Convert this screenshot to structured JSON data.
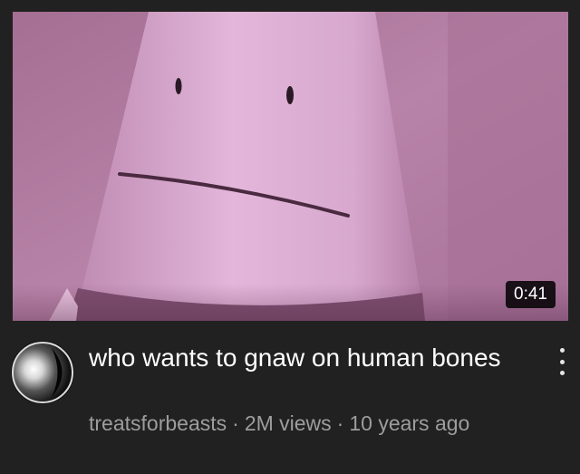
{
  "video": {
    "duration": "0:41",
    "title": "who wants to gnaw on human bones",
    "channel": "treatsforbeasts",
    "separator": "·",
    "views": "2M views",
    "age": "10 years ago"
  },
  "icons": {
    "avatar": "channel-avatar",
    "menu": "more-vert-icon"
  },
  "colors": {
    "background": "#212121",
    "title_text": "#ffffff",
    "meta_text": "#9d9d9d",
    "duration_badge": "#000000",
    "thumbnail_pink": "#c58bb3"
  }
}
